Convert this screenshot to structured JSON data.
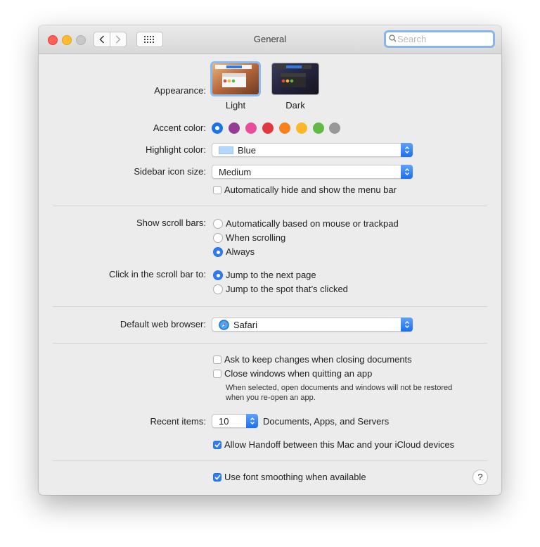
{
  "window": {
    "title": "General"
  },
  "search": {
    "placeholder": "Search",
    "value": ""
  },
  "appearance": {
    "label": "Appearance:",
    "options": [
      {
        "label": "Light",
        "selected": true
      },
      {
        "label": "Dark",
        "selected": false
      }
    ]
  },
  "accent": {
    "label": "Accent color:",
    "colors": [
      "#1a73e8",
      "#953d96",
      "#e84d9c",
      "#e0383e",
      "#f7821b",
      "#fcb827",
      "#62ba46",
      "#989898"
    ],
    "selected_index": 0
  },
  "highlight": {
    "label": "Highlight color:",
    "value": "Blue",
    "swatch": "#b3d7ff"
  },
  "sidebar_size": {
    "label": "Sidebar icon size:",
    "value": "Medium"
  },
  "menu_bar": {
    "label": "Automatically hide and show the menu bar",
    "checked": false
  },
  "scroll_bars": {
    "label": "Show scroll bars:",
    "options": [
      {
        "label": "Automatically based on mouse or trackpad",
        "selected": false
      },
      {
        "label": "When scrolling",
        "selected": false
      },
      {
        "label": "Always",
        "selected": true
      }
    ]
  },
  "click_scroll": {
    "label": "Click in the scroll bar to:",
    "options": [
      {
        "label": "Jump to the next page",
        "selected": true
      },
      {
        "label": "Jump to the spot that’s clicked",
        "selected": false
      }
    ]
  },
  "browser": {
    "label": "Default web browser:",
    "value": "Safari"
  },
  "ask_keep": {
    "label": "Ask to keep changes when closing documents",
    "checked": false
  },
  "close_windows": {
    "label": "Close windows when quitting an app",
    "checked": false,
    "note_line1": "When selected, open documents and windows will not be restored",
    "note_line2": "when you re-open an app."
  },
  "recent": {
    "label": "Recent items:",
    "value": "10",
    "suffix": "Documents, Apps, and Servers"
  },
  "handoff": {
    "label": "Allow Handoff between this Mac and your iCloud devices",
    "checked": true
  },
  "font_smoothing": {
    "label": "Use font smoothing when available",
    "checked": true
  },
  "help": {
    "label": "?"
  }
}
